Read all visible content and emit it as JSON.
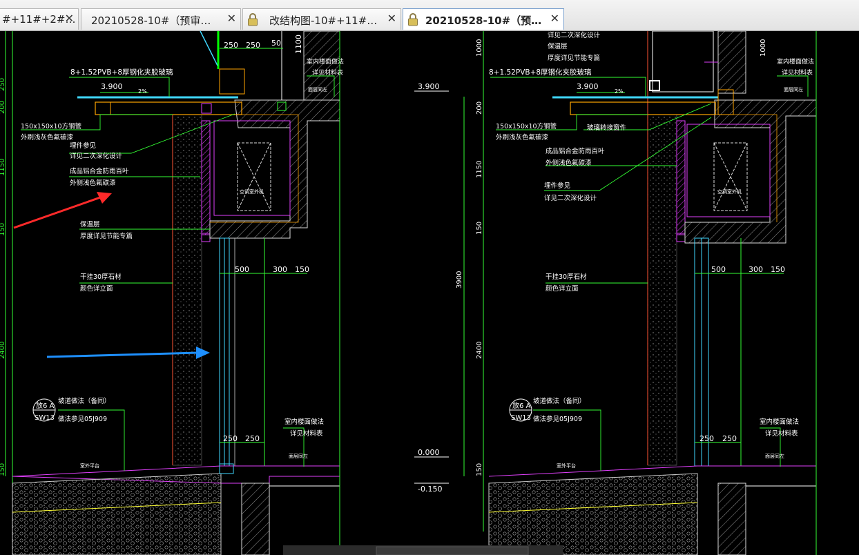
{
  "tabs": [
    {
      "label": "#+11#+2#…",
      "closable": true,
      "locked": false,
      "active": false
    },
    {
      "label": "20210528-10#（预审…",
      "closable": true,
      "locked": false,
      "active": false
    },
    {
      "label": "改结构图-10#+11#…",
      "closable": true,
      "locked": true,
      "active": false
    },
    {
      "label": "20210528-10#（预…",
      "closable": true,
      "locked": true,
      "active": true
    }
  ],
  "icons": {
    "close": "close-icon",
    "lock": "lock-icon"
  },
  "colors": {
    "lines": "#00ff00",
    "dims": "#33ff33",
    "hatch": "#e040fb",
    "glass": "#3fd7ff",
    "arrow_red": "#ff2a2a",
    "arrow_blue": "#1e90ff",
    "steel": "#ffa500"
  },
  "drawing": {
    "left": {
      "elev_3900": "3.900",
      "glass_spec": "8+1.52PVB+8厚钢化夹胶玻璃",
      "tube_spec": "150x150x10方钢管",
      "tube_finish": "外刷浅灰色氟碳漆",
      "embed_note": "埋件参见",
      "embed_note2": "详见二次深化设计",
      "louver": "成品铝合金防雨百叶",
      "louver_finish": "外侧浅色氟碳漆",
      "insul": "保温层",
      "insul_thk": "厚度详见节能专篇",
      "stone": "干挂30厚石材",
      "stone_color": "颜色详立面",
      "detail_tag": "放6 A",
      "detail_ref": "SW13",
      "slope_note": "坡道做法（备同）",
      "slope_ref": "做法参见05J909",
      "floor_note": "室内楼面做法",
      "floor_ref": "详见材料表",
      "platform": "室外平台",
      "slope_pct": "2%",
      "wall_finish": "面层同左",
      "ac_unit": "空调室外机",
      "dims_top": [
        "250",
        "250",
        "50",
        "1100"
      ],
      "dims_vert": [
        "250",
        "200",
        "1150",
        "150",
        "2400",
        "150"
      ],
      "dims_mid": [
        "500",
        "300",
        "150"
      ],
      "dims_bottom": [
        "250",
        "250"
      ]
    },
    "right": {
      "elev_3900a": "3.900",
      "elev_3900b": "3.900",
      "elev_0000": "0.000",
      "elev_m150": "-0.150",
      "n1": "详见二次深化设计",
      "n2": "保温层",
      "n3": "厚度详见节能专篇",
      "glass_spec": "8+1.52PVB+8厚钢化夹胶玻璃",
      "tube_spec": "150x150x10方钢管",
      "tube_finish": "外刷浅灰色氟碳漆",
      "glass_bracket": "玻璃转接窗件",
      "louver": "成品铝合金防雨百叶",
      "louver_finish": "外侧浅色氟碳漆",
      "embed_note": "埋件参见",
      "embed_note2": "详见二次深化设计",
      "stone": "干挂30厚石材",
      "stone_color": "颜色详立面",
      "detail_tag": "放6 A",
      "detail_ref": "SW13",
      "slope_note": "坡道做法（备同）",
      "slope_ref": "做法参见05J909",
      "floor_note": "室内楼面做法",
      "floor_ref": "详见材料表",
      "platform": "室外平台",
      "slope_pct": "2%",
      "wall_finish": "面层同左",
      "ac_unit": "空调室外机",
      "dims_vert": [
        "1000",
        "200",
        "1150",
        "150",
        "3900",
        "2400",
        "150"
      ],
      "dims_top": [
        "1000"
      ],
      "dims_mid": [
        "500",
        "300",
        "150"
      ],
      "dims_bottom": [
        "250",
        "250"
      ]
    }
  }
}
